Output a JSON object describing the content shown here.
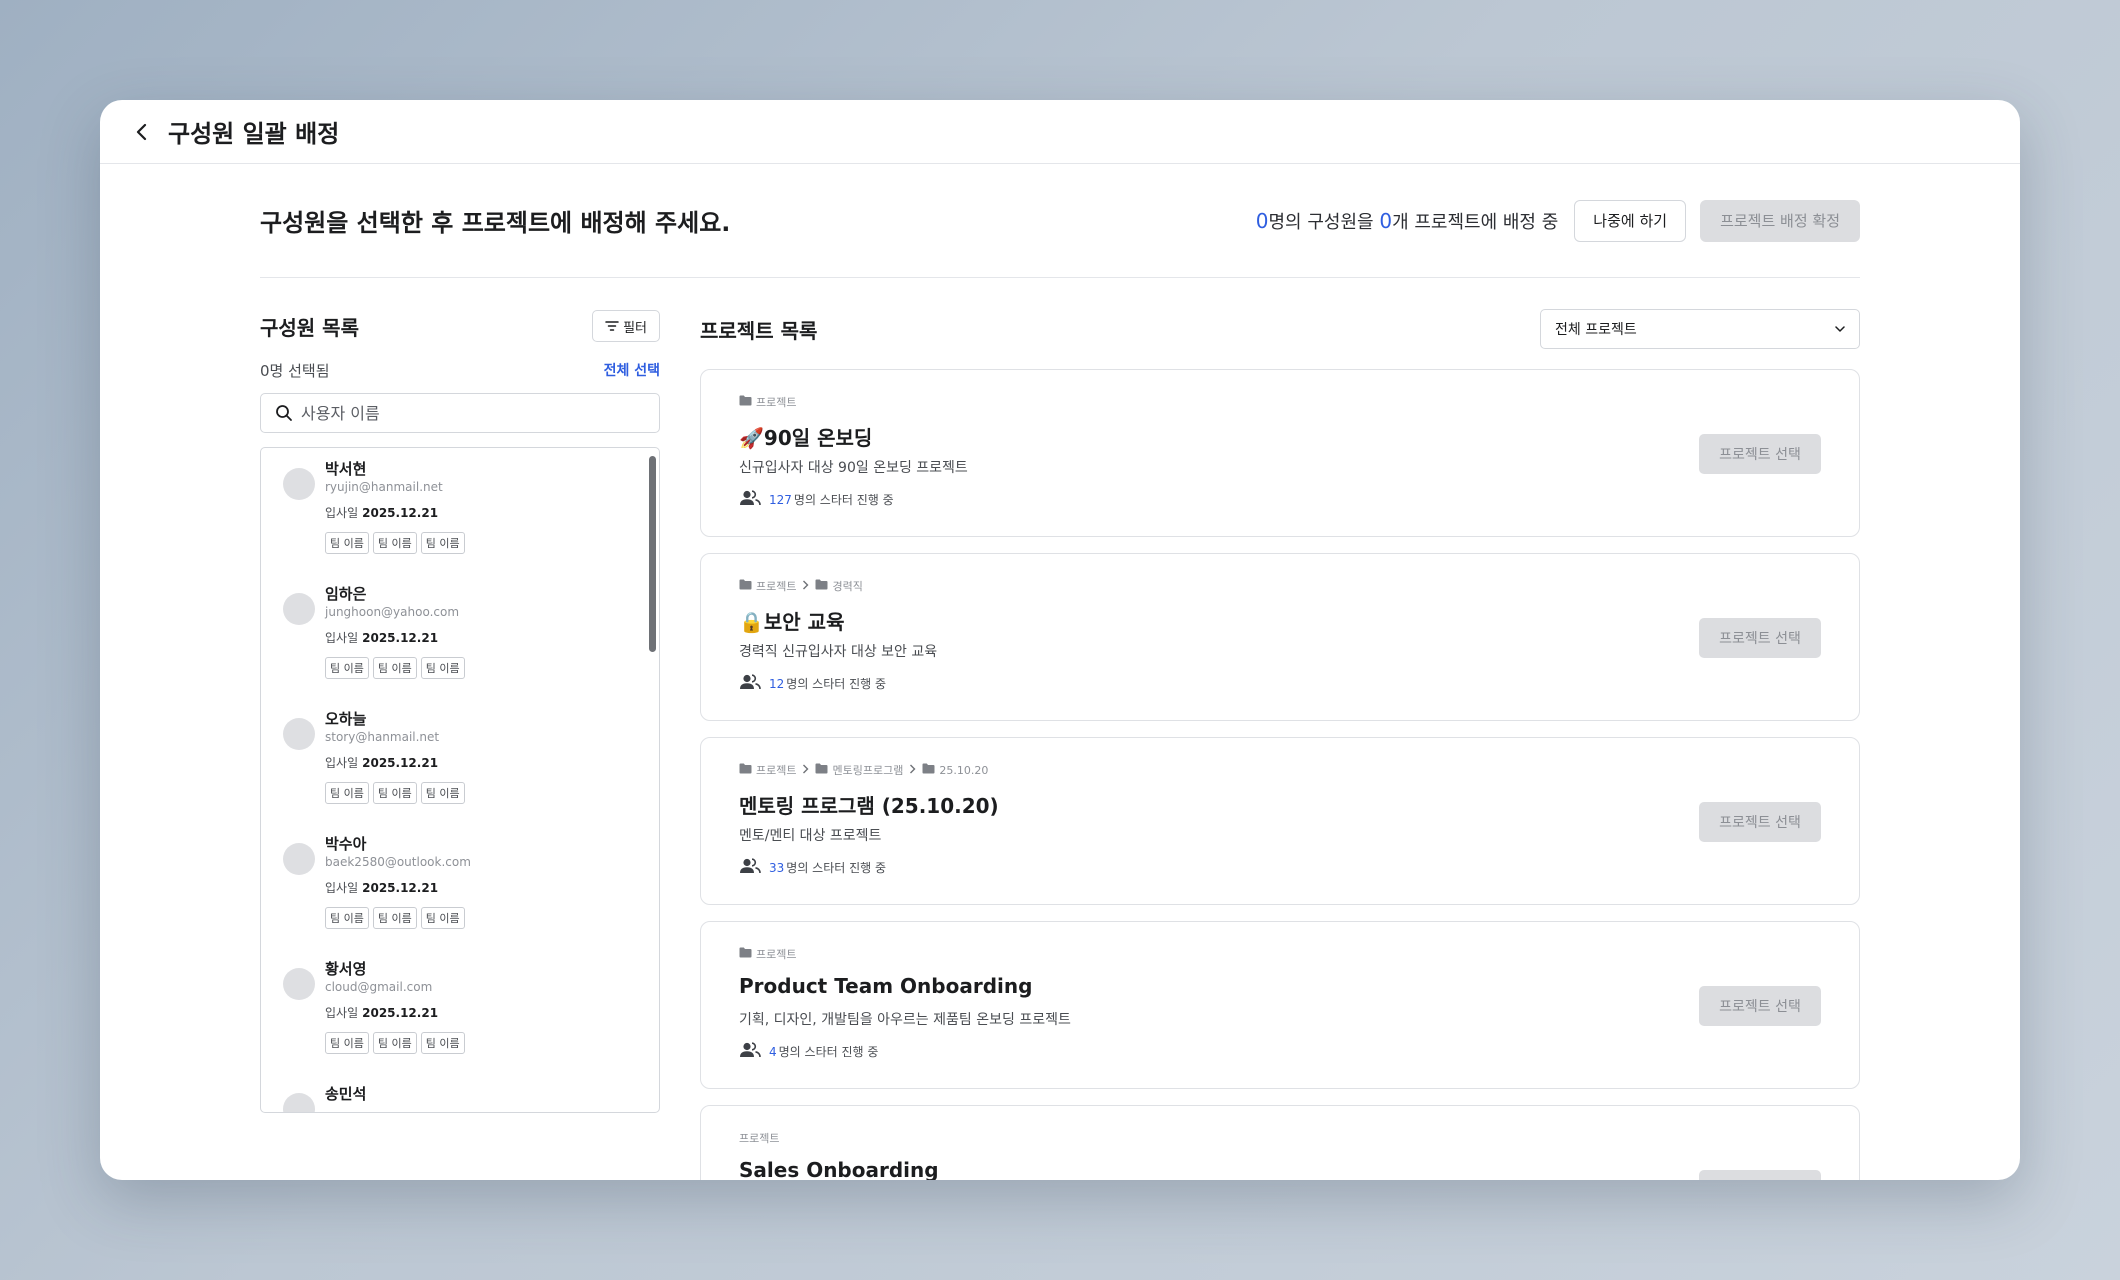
{
  "window": {
    "title": "구성원 일괄 배정"
  },
  "header": {
    "headline": "구성원을 선택한 후 프로젝트에 배정해 주세요.",
    "status_member_count": "0",
    "status_member_suffix": "명의 구성원을",
    "status_project_count": "0",
    "status_project_suffix": "개 프로젝트에 배정 중",
    "later_label": "나중에 하기",
    "confirm_label": "프로젝트 배정 확정"
  },
  "members_panel": {
    "title": "구성원 목록",
    "filter_label": "필터",
    "selected_count": "0명 선택됨",
    "select_all_label": "전체 선택",
    "search_placeholder": "사용자 이름",
    "join_label": "입사일",
    "members": [
      {
        "name": "박서현",
        "email": "ryujin@hanmail.net",
        "join_date": "2025.12.21",
        "tags": [
          "팀 이름",
          "팀 이름",
          "팀 이름"
        ]
      },
      {
        "name": "임하은",
        "email": "junghoon@yahoo.com",
        "join_date": "2025.12.21",
        "tags": [
          "팀 이름",
          "팀 이름",
          "팀 이름"
        ]
      },
      {
        "name": "오하늘",
        "email": "story@hanmail.net",
        "join_date": "2025.12.21",
        "tags": [
          "팀 이름",
          "팀 이름",
          "팀 이름"
        ]
      },
      {
        "name": "박수아",
        "email": "baek2580@outlook.com",
        "join_date": "2025.12.21",
        "tags": [
          "팀 이름",
          "팀 이름",
          "팀 이름"
        ]
      },
      {
        "name": "황서영",
        "email": "cloud@gmail.com",
        "join_date": "2025.12.21",
        "tags": [
          "팀 이름",
          "팀 이름",
          "팀 이름"
        ]
      },
      {
        "name": "송민석"
      }
    ]
  },
  "projects_panel": {
    "title": "프로젝트 목록",
    "dropdown_value": "전체 프로젝트",
    "count_suffix": "명의 스타터 진행 중",
    "select_label": "프로젝트 선택",
    "projects": [
      {
        "breadcrumb": [
          "프로젝트"
        ],
        "emoji": "🚀",
        "title": "90일 온보딩",
        "description": "신규입사자 대상 90일 온보딩 프로젝트",
        "count": "127"
      },
      {
        "breadcrumb": [
          "프로젝트",
          "경력직"
        ],
        "emoji": "🔒",
        "title": "보안 교육",
        "description": "경력직 신규입사자 대상 보안 교육",
        "count": "12"
      },
      {
        "breadcrumb": [
          "프로젝트",
          "멘토링프로그램",
          "25.10.20"
        ],
        "emoji": "",
        "title": "멘토링 프로그램 (25.10.20)",
        "description": "멘토/멘티 대상 프로젝트",
        "count": "33"
      },
      {
        "breadcrumb": [
          "프로젝트"
        ],
        "emoji": "",
        "title": "Product Team Onboarding",
        "description": "기획, 디자인, 개발팀을 아우르는 제품팀 온보딩 프로젝트",
        "count": "4"
      },
      {
        "breadcrumb": [
          "프로젝트"
        ],
        "emoji": "",
        "title": "Sales Onboarding"
      }
    ]
  }
}
